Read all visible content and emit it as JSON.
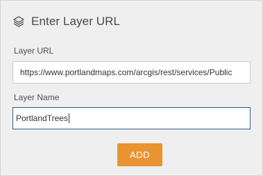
{
  "header": {
    "icon": "layers-icon",
    "title": "Enter Layer URL"
  },
  "form": {
    "url_label": "Layer URL",
    "url_value": "https://www.portlandmaps.com/arcgis/rest/services/Public",
    "name_label": "Layer Name",
    "name_value": "PortlandTrees"
  },
  "actions": {
    "add_label": "ADD"
  },
  "colors": {
    "panel_bg": "#efefef",
    "accent_button": "#e99431",
    "focus_border": "#2e5c8a"
  }
}
